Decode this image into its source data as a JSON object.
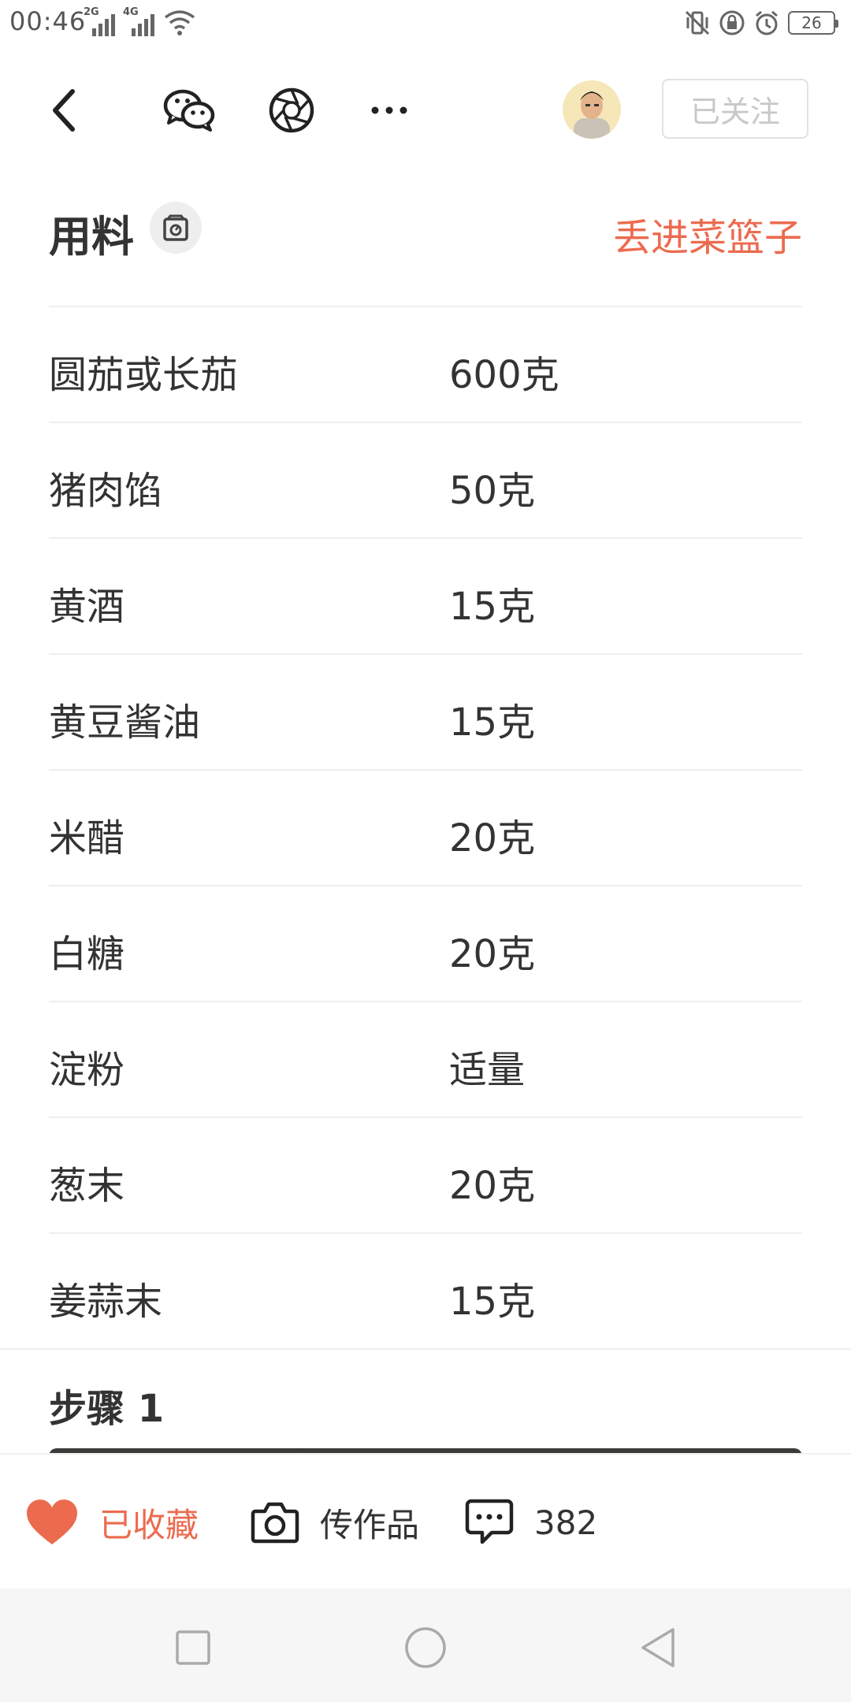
{
  "status_bar": {
    "time": "00:46",
    "sim1_type": "2G",
    "sim2_type": "4G",
    "battery": "26"
  },
  "nav": {
    "follow_label": "已关注"
  },
  "ingredients": {
    "title": "用料",
    "basket_label": "丢进菜篮子",
    "items": [
      {
        "name": "圆茄或长茄",
        "amount": "600克"
      },
      {
        "name": "猪肉馅",
        "amount": "50克"
      },
      {
        "name": "黄酒",
        "amount": "15克"
      },
      {
        "name": "黄豆酱油",
        "amount": "15克"
      },
      {
        "name": "米醋",
        "amount": "20克"
      },
      {
        "name": "白糖",
        "amount": "20克"
      },
      {
        "name": "淀粉",
        "amount": "适量"
      },
      {
        "name": "葱末",
        "amount": "20克"
      },
      {
        "name": "姜蒜末",
        "amount": "15克"
      }
    ]
  },
  "steps": {
    "step1_title": "步骤 1"
  },
  "actions": {
    "favorite_label": "已收藏",
    "upload_label": "传作品",
    "comment_count": "382"
  },
  "colors": {
    "accent": "#ec6b4f",
    "text": "#333333",
    "divider": "#eeeeee"
  }
}
